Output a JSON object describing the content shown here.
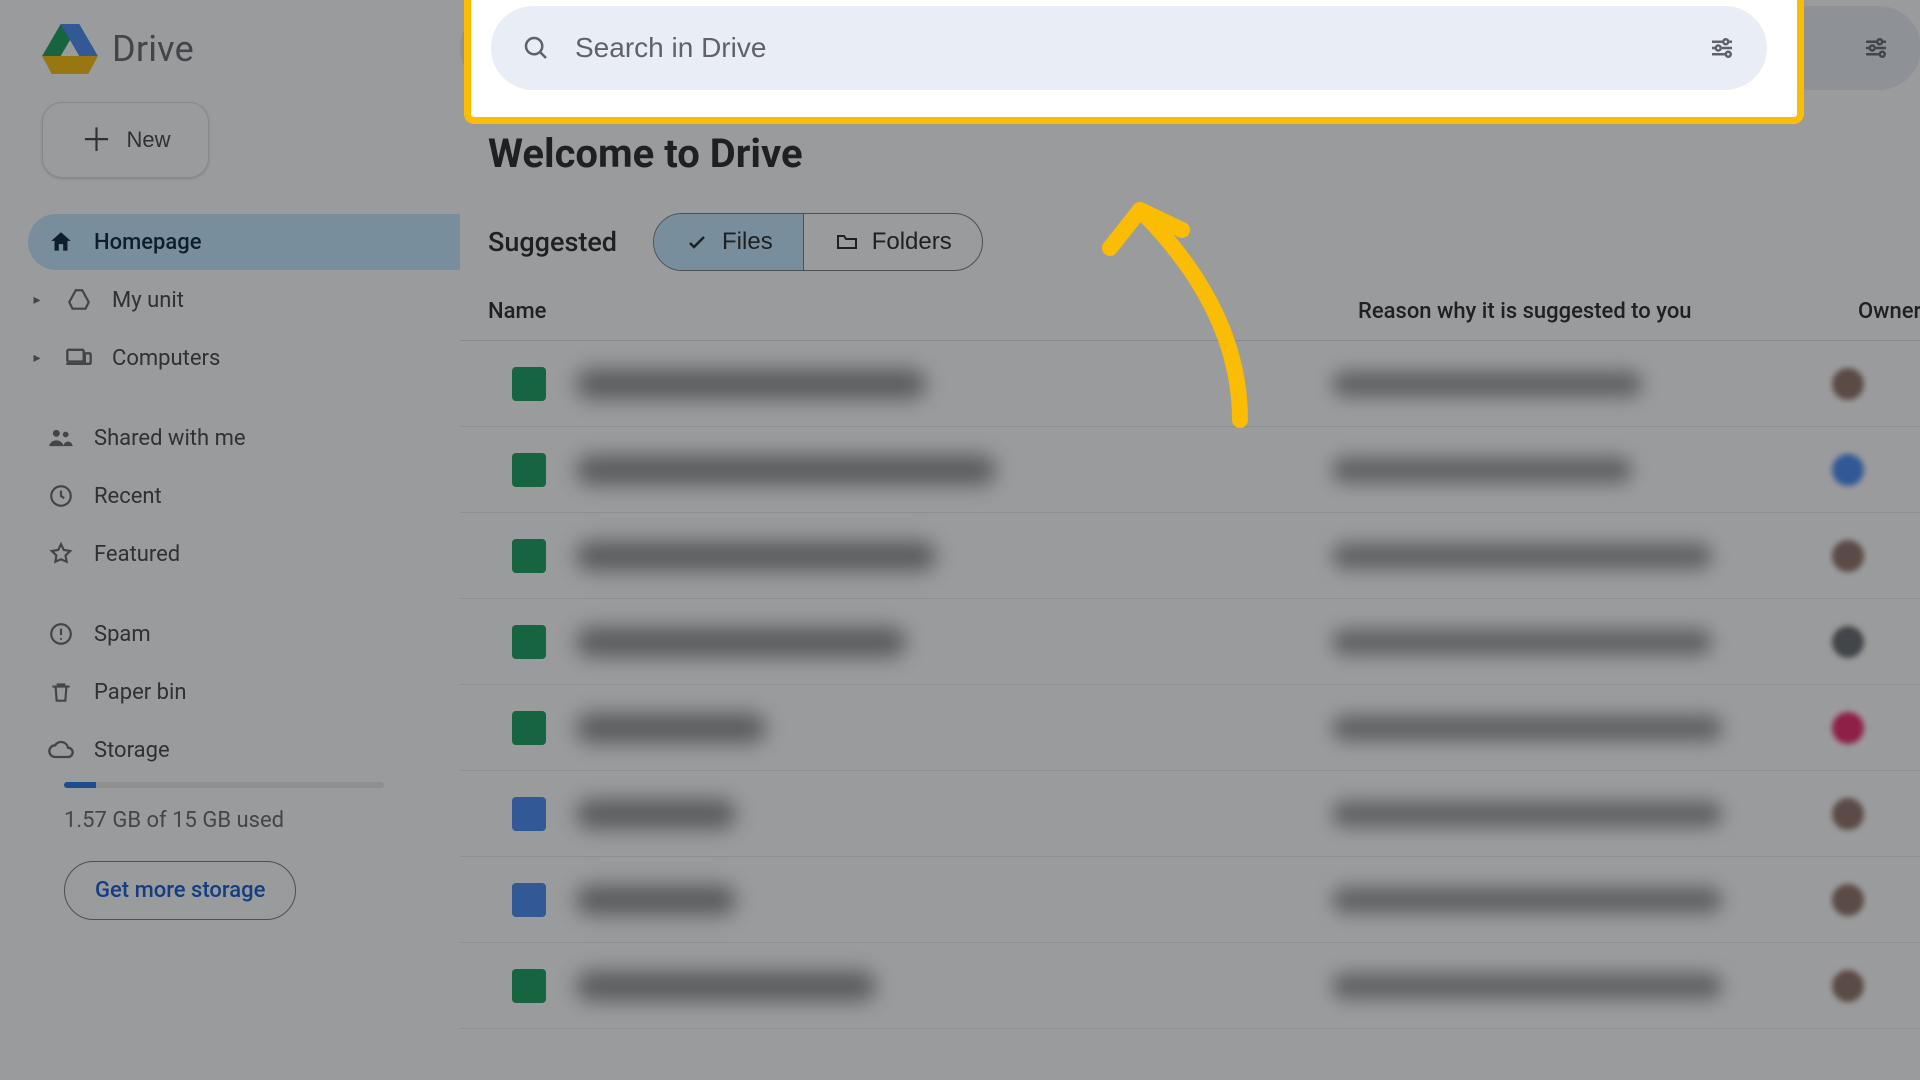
{
  "brand": {
    "name": "Drive"
  },
  "newButton": {
    "label": "New"
  },
  "sidebar": {
    "items": [
      {
        "label": "Homepage"
      },
      {
        "label": "My unit"
      },
      {
        "label": "Computers"
      },
      {
        "label": "Shared with me"
      },
      {
        "label": "Recent"
      },
      {
        "label": "Featured"
      },
      {
        "label": "Spam"
      },
      {
        "label": "Paper bin"
      },
      {
        "label": "Storage"
      }
    ]
  },
  "storage": {
    "used_text": "1.57 GB of 15 GB used",
    "cta": "Get more storage"
  },
  "search": {
    "placeholder": "Search in Drive"
  },
  "main": {
    "title": "Welcome to Drive",
    "suggested_label": "Suggested",
    "seg_files": "Files",
    "seg_folders": "Folders",
    "columns": {
      "name": "Name",
      "reason": "Reason why it is suggested to you",
      "owner": "Owner"
    }
  },
  "rows": [
    {
      "icon_color": "green",
      "name_w": 350,
      "reason_w": 310,
      "avatar": "#8d6e63"
    },
    {
      "icon_color": "green",
      "name_w": 420,
      "reason_w": 300,
      "avatar": "#4285f4"
    },
    {
      "icon_color": "green",
      "name_w": 360,
      "reason_w": 380,
      "avatar": "#8d6e63"
    },
    {
      "icon_color": "green",
      "name_w": 330,
      "reason_w": 380,
      "avatar": "#5f6368"
    },
    {
      "icon_color": "green",
      "name_w": 190,
      "reason_w": 390,
      "avatar": "#e91e63"
    },
    {
      "icon_color": "blue",
      "name_w": 160,
      "reason_w": 390,
      "avatar": "#8d6e63"
    },
    {
      "icon_color": "blue",
      "name_w": 160,
      "reason_w": 390,
      "avatar": "#8d6e63"
    },
    {
      "icon_color": "green",
      "name_w": 300,
      "reason_w": 390,
      "avatar": "#8d6e63"
    }
  ]
}
